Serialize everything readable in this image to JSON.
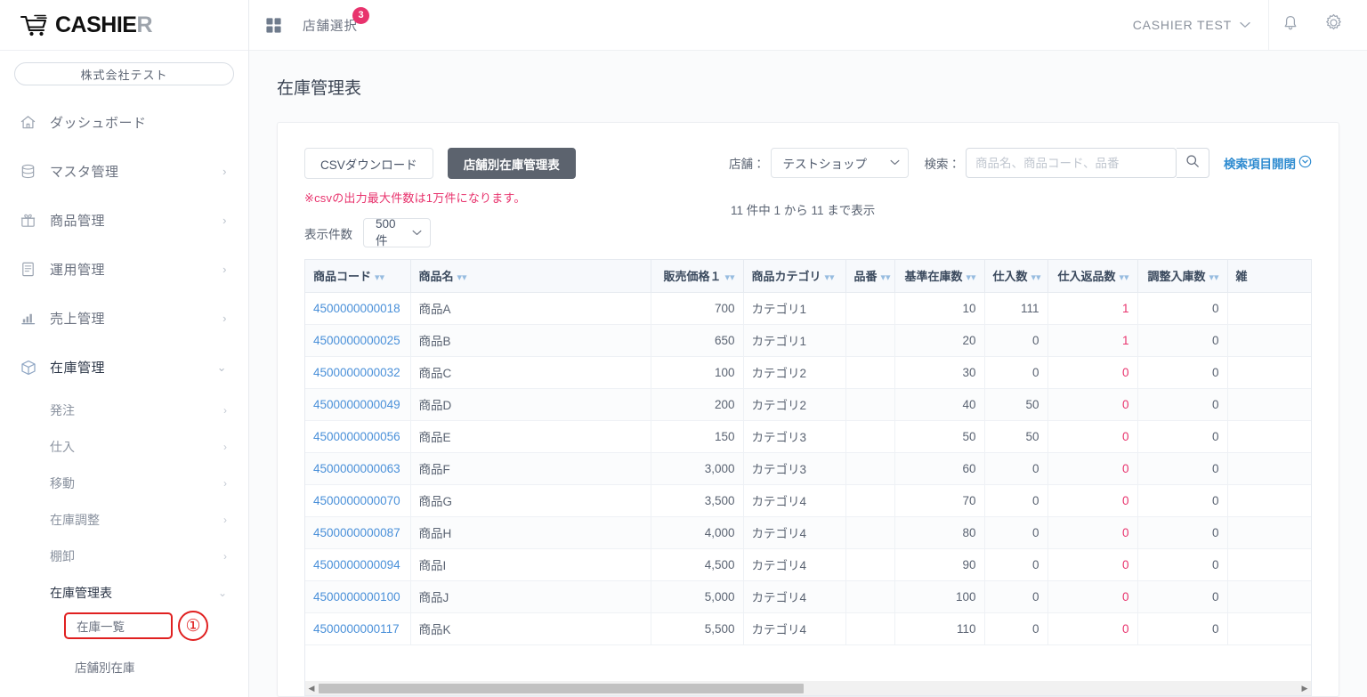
{
  "brand": {
    "name_dark": "CASHIE",
    "name_light": "R",
    "logo_icon": "shopping-cart-icon"
  },
  "topbar": {
    "grid_icon": "grid-apps-icon",
    "store_select_label": "店舗選択",
    "store_select_badge": "3",
    "user_name": "CASHIER  TEST",
    "bell_icon": "bell-icon",
    "gear_icon": "gear-icon",
    "chevron_icon": "chevron-down-icon"
  },
  "sidebar": {
    "company": "株式会社テスト",
    "items": [
      {
        "label": "ダッシュボード",
        "icon": "home-icon",
        "chevron": ""
      },
      {
        "label": "マスタ管理",
        "icon": "database-icon",
        "chevron": "›"
      },
      {
        "label": "商品管理",
        "icon": "gift-icon",
        "chevron": "›"
      },
      {
        "label": "運用管理",
        "icon": "document-icon",
        "chevron": "›"
      },
      {
        "label": "売上管理",
        "icon": "bar-chart-icon",
        "chevron": "›"
      },
      {
        "label": "在庫管理",
        "icon": "box-icon",
        "chevron": "⌄"
      }
    ],
    "subitems": [
      {
        "label": "発注",
        "chevron": "›"
      },
      {
        "label": "仕入",
        "chevron": "›"
      },
      {
        "label": "移動",
        "chevron": "›"
      },
      {
        "label": "在庫調整",
        "chevron": "›"
      },
      {
        "label": "棚卸",
        "chevron": "›"
      },
      {
        "label": "在庫管理表",
        "chevron": "⌄"
      }
    ],
    "leaf_highlighted": "在庫一覧",
    "leaf_callout": "①",
    "leaf_plain": "店舗別在庫"
  },
  "page": {
    "title": "在庫管理表"
  },
  "toolbar": {
    "csv_button": "CSVダウンロード",
    "store_report_button": "店舗別在庫管理表",
    "csv_note": "※csvの出力最大件数は1万件になります。",
    "display_count_label": "表示件数",
    "display_count_value": "500件",
    "store_label": "店舗：",
    "store_value": "テストショップ",
    "search_label": "検索：",
    "search_value": "",
    "search_placeholder": "商品名、商品コード、品番",
    "search_icon": "search-icon",
    "toggle_search_fields": "検索項目開閉",
    "toggle_icon": "chevron-down-circle-icon",
    "result_count": "11 件中 1 から 11 まで表示"
  },
  "table": {
    "columns": [
      {
        "label": "商品コード",
        "sortable": true,
        "align": "left"
      },
      {
        "label": "商品名",
        "sortable": true,
        "align": "left"
      },
      {
        "label": "販売価格１",
        "sortable": true,
        "align": "right"
      },
      {
        "label": "商品カテゴリ",
        "sortable": true,
        "align": "left"
      },
      {
        "label": "品番",
        "sortable": true,
        "align": "left"
      },
      {
        "label": "基準在庫数",
        "sortable": true,
        "align": "right"
      },
      {
        "label": "仕入数",
        "sortable": true,
        "align": "right"
      },
      {
        "label": "仕入返品数",
        "sortable": true,
        "align": "right"
      },
      {
        "label": "調整入庫数",
        "sortable": true,
        "align": "right"
      },
      {
        "label": "雑",
        "sortable": false,
        "align": "left"
      }
    ],
    "sort_icon": "chevron-double-down-icon",
    "rows": [
      {
        "code": "4500000000018",
        "name": "商品A",
        "price": "700",
        "category": "カテゴリ1",
        "partno": "",
        "base_stock": "10",
        "purchase": "111",
        "purchase_return": "1",
        "adjust_in": "0",
        "misc": ""
      },
      {
        "code": "4500000000025",
        "name": "商品B",
        "price": "650",
        "category": "カテゴリ1",
        "partno": "",
        "base_stock": "20",
        "purchase": "0",
        "purchase_return": "1",
        "adjust_in": "0",
        "misc": ""
      },
      {
        "code": "4500000000032",
        "name": "商品C",
        "price": "100",
        "category": "カテゴリ2",
        "partno": "",
        "base_stock": "30",
        "purchase": "0",
        "purchase_return": "0",
        "adjust_in": "0",
        "misc": ""
      },
      {
        "code": "4500000000049",
        "name": "商品D",
        "price": "200",
        "category": "カテゴリ2",
        "partno": "",
        "base_stock": "40",
        "purchase": "50",
        "purchase_return": "0",
        "adjust_in": "0",
        "misc": ""
      },
      {
        "code": "4500000000056",
        "name": "商品E",
        "price": "150",
        "category": "カテゴリ3",
        "partno": "",
        "base_stock": "50",
        "purchase": "50",
        "purchase_return": "0",
        "adjust_in": "0",
        "misc": ""
      },
      {
        "code": "4500000000063",
        "name": "商品F",
        "price": "3,000",
        "category": "カテゴリ3",
        "partno": "",
        "base_stock": "60",
        "purchase": "0",
        "purchase_return": "0",
        "adjust_in": "0",
        "misc": ""
      },
      {
        "code": "4500000000070",
        "name": "商品G",
        "price": "3,500",
        "category": "カテゴリ4",
        "partno": "",
        "base_stock": "70",
        "purchase": "0",
        "purchase_return": "0",
        "adjust_in": "0",
        "misc": ""
      },
      {
        "code": "4500000000087",
        "name": "商品H",
        "price": "4,000",
        "category": "カテゴリ4",
        "partno": "",
        "base_stock": "80",
        "purchase": "0",
        "purchase_return": "0",
        "adjust_in": "0",
        "misc": ""
      },
      {
        "code": "4500000000094",
        "name": "商品I",
        "price": "4,500",
        "category": "カテゴリ4",
        "partno": "",
        "base_stock": "90",
        "purchase": "0",
        "purchase_return": "0",
        "adjust_in": "0",
        "misc": ""
      },
      {
        "code": "4500000000100",
        "name": "商品J",
        "price": "5,000",
        "category": "カテゴリ4",
        "partno": "",
        "base_stock": "100",
        "purchase": "0",
        "purchase_return": "0",
        "adjust_in": "0",
        "misc": ""
      },
      {
        "code": "4500000000117",
        "name": "商品K",
        "price": "5,500",
        "category": "カテゴリ4",
        "partno": "",
        "base_stock": "110",
        "purchase": "0",
        "purchase_return": "0",
        "adjust_in": "0",
        "misc": ""
      }
    ]
  },
  "scrollbar": {
    "left_arrow": "◀",
    "right_arrow": "▶"
  },
  "colors": {
    "accent_pink": "#e8336d",
    "link_blue": "#4a90d9",
    "toggle_blue": "#2e8bd0",
    "dark_button": "#5c636e",
    "highlight_red": "#e02020",
    "header_bg": "#f7f9fc"
  }
}
